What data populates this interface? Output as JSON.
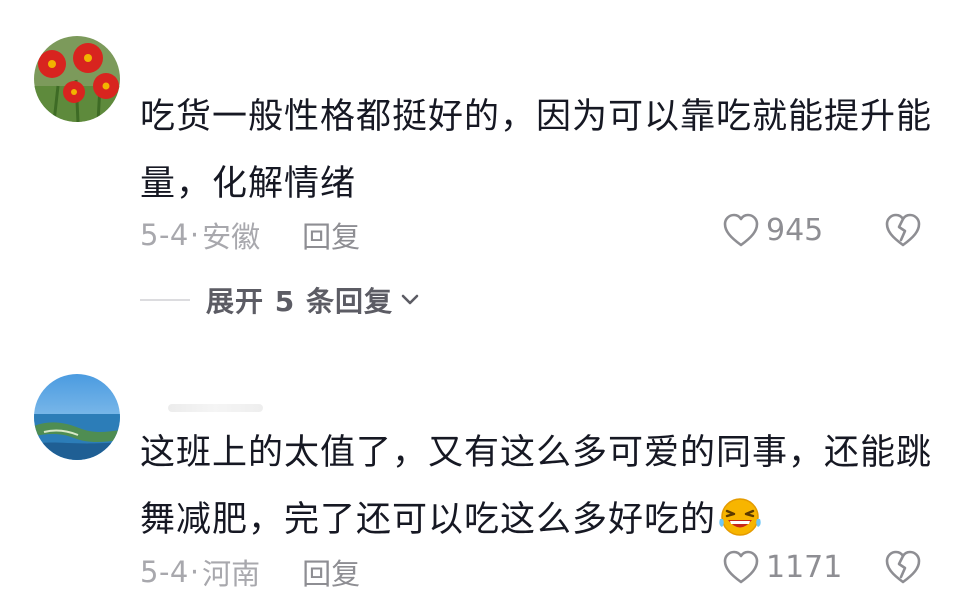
{
  "comments": [
    {
      "text_lines": [
        "吃货一般性格都挺好的，因为可以靠吃就能提升能",
        "量，化解情绪"
      ],
      "date": "5-4",
      "separator": "·",
      "location": "安徽",
      "reply_label": "回复",
      "likes": "945",
      "expand_replies_label": "展开 5 条回复"
    },
    {
      "text_lines": [
        "这班上的太值了，又有这么多可爱的同事，还能跳",
        "舞减肥，完了还可以吃这么多好吃的"
      ],
      "date": "5-4",
      "separator": "·",
      "location": "河南",
      "reply_label": "回复",
      "likes": "1171"
    }
  ],
  "icons": {
    "like": "heart-outline-icon",
    "dislike": "broken-heart-icon",
    "expand": "chevron-down-icon",
    "emoji": "laughing-emoji-icon"
  },
  "colors": {
    "text": "#161823",
    "meta": "#a8a8ad",
    "secondary": "#8e8e93"
  }
}
